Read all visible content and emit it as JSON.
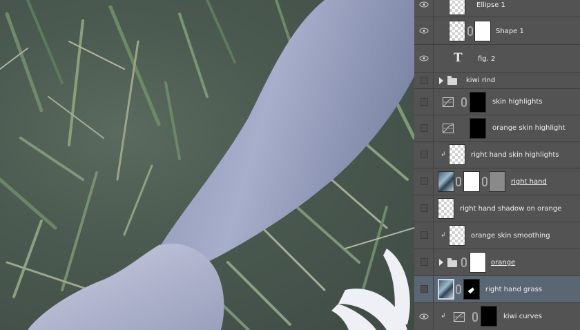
{
  "layers": [
    {
      "name": "Ellipse 1",
      "visible": true
    },
    {
      "name": "Shape 1",
      "visible": true
    },
    {
      "name": "fig. 2",
      "visible": true
    },
    {
      "name": "kiwi rind",
      "visible": false
    },
    {
      "name": "skin highlights",
      "visible": false
    },
    {
      "name": "orange skin highlight",
      "visible": false
    },
    {
      "name": "right hand skin highlights",
      "visible": false
    },
    {
      "name": "right hand",
      "visible": false
    },
    {
      "name": "right hand shadow on orange",
      "visible": false
    },
    {
      "name": "orange skin smoothing",
      "visible": false
    },
    {
      "name": "orange",
      "visible": false
    },
    {
      "name": "right hand grass",
      "visible": false,
      "selected": true
    },
    {
      "name": "kiwi curves",
      "visible": true
    }
  ],
  "icons": {
    "eye": "eye-icon",
    "link": "chain-link-icon",
    "adjustment": "curves-adjustment-icon",
    "clipping": "clipping-mask-arrow-icon",
    "folder": "folder-icon",
    "expand": "expand-triangle-icon",
    "text": "text-layer-icon"
  },
  "colors": {
    "panel_bg": "#535353",
    "selected_row": "#5b6675",
    "text": "#efefef"
  }
}
